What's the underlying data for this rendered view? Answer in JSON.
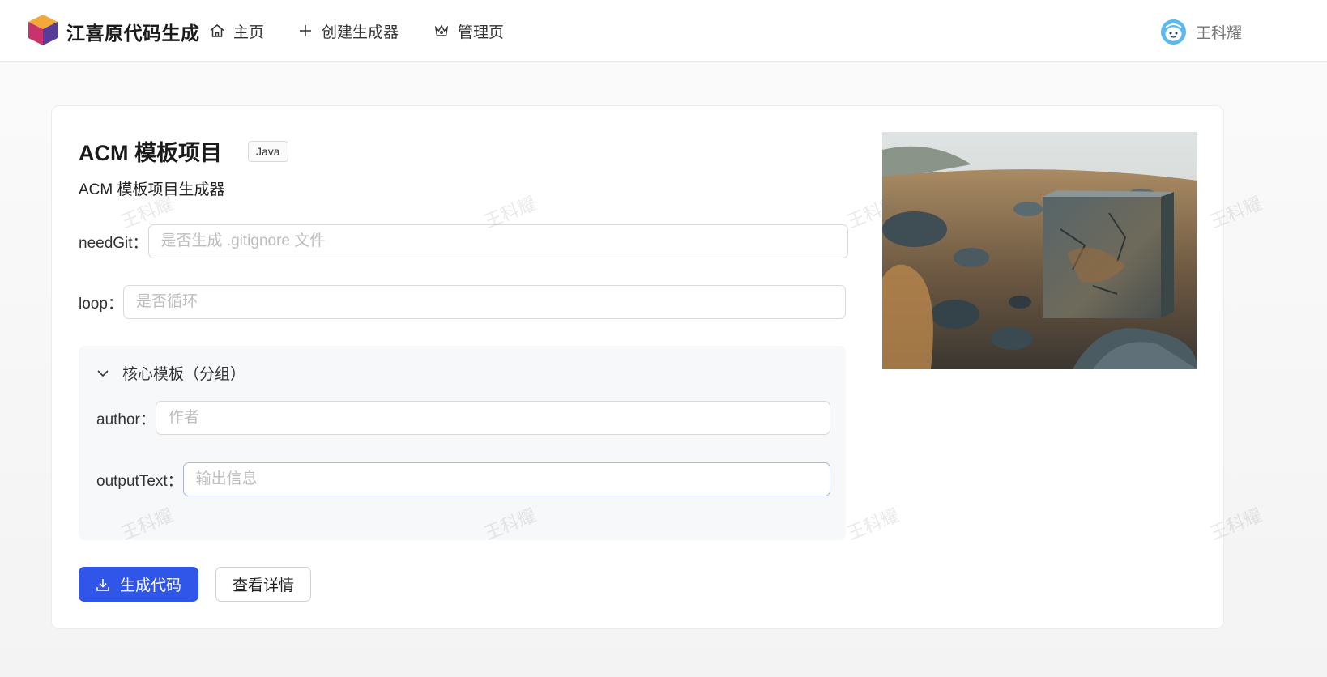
{
  "header": {
    "brand": "江喜原代码生成",
    "nav": [
      {
        "label": "主页",
        "icon": "home-icon"
      },
      {
        "label": "创建生成器",
        "icon": "plus-icon"
      },
      {
        "label": "管理页",
        "icon": "crown-icon"
      }
    ],
    "user": {
      "name": "王科耀",
      "avatar_icon": "avatar-icon"
    }
  },
  "generator": {
    "title": "ACM 模板项目",
    "tag": "Java",
    "description": "ACM 模板项目生成器",
    "fields": [
      {
        "label": "needGit：",
        "placeholder": "是否生成 .gitignore 文件",
        "value": ""
      },
      {
        "label": "loop：",
        "placeholder": "是否循环",
        "value": ""
      }
    ],
    "group": {
      "title": "核心模板（分组）",
      "expanded": true,
      "fields": [
        {
          "label": "author：",
          "placeholder": "作者",
          "value": ""
        },
        {
          "label": "outputText：",
          "placeholder": "输出信息",
          "value": ""
        }
      ]
    },
    "actions": {
      "generate_label": "生成代码",
      "details_label": "查看详情"
    },
    "cover_image": "rocky-landscape-with-stone-cube"
  },
  "watermark": "王科耀",
  "colors": {
    "primary": "#2f56e8",
    "header_bg": "#ffffff",
    "group_bg": "#f7f8fa",
    "placeholder": "#bdbdbd"
  }
}
